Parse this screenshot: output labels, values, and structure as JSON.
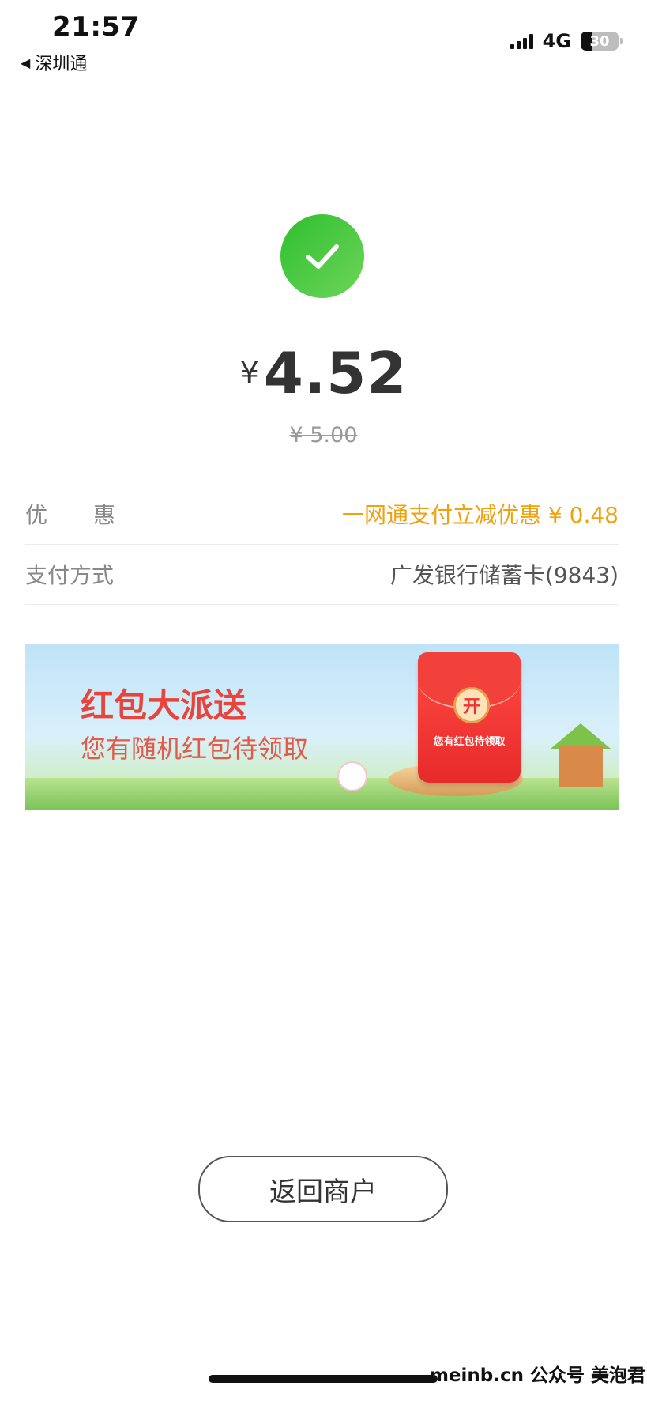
{
  "status_bar": {
    "time": "21:57",
    "back_app": "深圳通",
    "network": "4G",
    "battery": "30",
    "battery_level": 0.3
  },
  "payment": {
    "amount_symbol": "¥",
    "amount": "4.52",
    "original_amount": "¥ 5.00"
  },
  "details": [
    {
      "label": "优惠",
      "value": "一网通支付立减优惠 ¥ 0.48"
    },
    {
      "label": "支付方式",
      "value": "广发银行储蓄卡(9843)"
    }
  ],
  "banner": {
    "title": "红包大派送",
    "subtitle": "您有随机红包待领取",
    "envelope_open": "开",
    "envelope_text": "您有红包待领取"
  },
  "return_button": "返回商户",
  "watermark": "meinb.cn  公众号 美泡君",
  "colors": {
    "success_green": "#2fbf2f",
    "discount_orange": "#f0a10e",
    "banner_red": "#e8443b"
  },
  "icons": {
    "success": "checkmark-icon",
    "back": "back-triangle-icon"
  }
}
